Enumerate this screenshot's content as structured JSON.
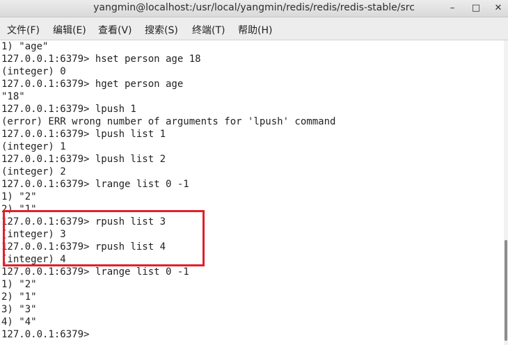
{
  "window": {
    "title": "yangmin@localhost:/usr/local/yangmin/redis/redis/redis-stable/src",
    "minimize_glyph": "–",
    "maximize_glyph": "□",
    "close_glyph": "✕"
  },
  "menu": [
    "文件(F)",
    "编辑(E)",
    "查看(V)",
    "搜索(S)",
    "终端(T)",
    "帮助(H)"
  ],
  "terminal": {
    "lines": [
      "1) \"age\"",
      "127.0.0.1:6379> hset person age 18",
      "(integer) 0",
      "127.0.0.1:6379> hget person age",
      "\"18\"",
      "127.0.0.1:6379> lpush 1",
      "(error) ERR wrong number of arguments for 'lpush' command",
      "127.0.0.1:6379> lpush list 1",
      "(integer) 1",
      "127.0.0.1:6379> lpush list 2",
      "(integer) 2",
      "127.0.0.1:6379> lrange list 0 -1",
      "1) \"2\"",
      "2) \"1\"",
      "127.0.0.1:6379> rpush list 3",
      "(integer) 3",
      "127.0.0.1:6379> rpush list 4",
      "(integer) 4",
      "127.0.0.1:6379> lrange list 0 -1",
      "1) \"2\"",
      "2) \"1\"",
      "3) \"3\"",
      "4) \"4\"",
      "127.0.0.1:6379>"
    ]
  },
  "colors": {
    "highlight": "#e0202a"
  }
}
